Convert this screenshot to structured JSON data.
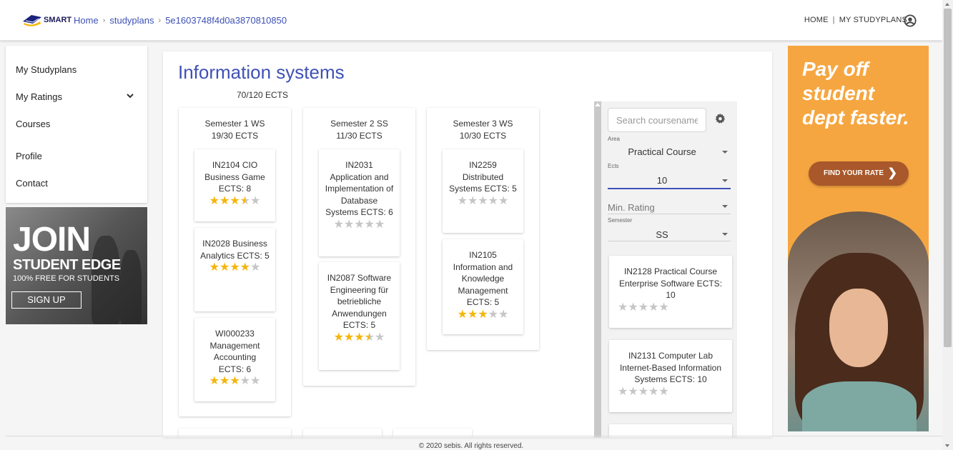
{
  "header": {
    "brand": "SMART",
    "breadcrumbs": [
      "Home",
      "studyplans",
      "5e1603748f4d0a3870810850"
    ],
    "nav_home": "HOME",
    "nav_separator": "|",
    "nav_studyplans": "MY STUDYPLANS"
  },
  "sidebar": {
    "items": [
      {
        "label": "My Studyplans"
      },
      {
        "label": "My Ratings"
      },
      {
        "label": "Courses"
      },
      {
        "label": "Profile"
      },
      {
        "label": "Contact"
      }
    ]
  },
  "ad_left": {
    "line1": "JOIN",
    "line2": "STUDENT EDGE",
    "line3": "100% FREE FOR STUDENTS",
    "button": "SIGN UP"
  },
  "plan": {
    "title": "Information systems",
    "ects_progress": "70/120 ECTS",
    "ects_done": 70,
    "ects_required": 120,
    "semesters": [
      {
        "title": "Semester 1 WS",
        "ects": "19/30 ECTS",
        "courses": [
          {
            "text": "IN2104 CIO Business Game ECTS: 8",
            "rating": 3.5
          },
          {
            "text": "IN2028 Business Analytics ECTS: 5",
            "rating": 4
          },
          {
            "text": "WI000233 Management Accounting ECTS: 6",
            "rating": 3
          }
        ]
      },
      {
        "title": "Semester 2 SS",
        "ects": "11/30 ECTS",
        "courses": [
          {
            "text": "IN2031 Application and Implementation of Database Systems ECTS: 6",
            "rating": 0
          },
          {
            "text": "IN2087 Software Engineering für betriebliche Anwendungen ECTS: 5",
            "rating": 3.5
          }
        ]
      },
      {
        "title": "Semester 3 WS",
        "ects": "10/30 ECTS",
        "courses": [
          {
            "text": "IN2259 Distributed Systems ECTS: 5",
            "rating": 0
          },
          {
            "text": "IN2105 Information and Knowledge Management ECTS: 5",
            "rating": 3
          }
        ]
      }
    ]
  },
  "filters": {
    "search_placeholder": "Search coursename",
    "area_label": "Area",
    "area_value": "Practical Course",
    "ects_label": "Ects",
    "ects_value": "10",
    "rating_placeholder": "Min. Rating",
    "semester_label": "Semester",
    "semester_value": "SS"
  },
  "results": [
    {
      "text": "IN2128 Practical Course Enterprise Software ECTS: 10",
      "rating": 0
    },
    {
      "text": "IN2131 Computer Lab Internet-Based Information Systems ECTS: 10",
      "rating": 0
    }
  ],
  "ad_right": {
    "line1": "Pay off",
    "line2": "student",
    "line3": "dept faster.",
    "button": "FIND YOUR RATE"
  },
  "footer": "© 2020 sebis. All rights reserved.",
  "colors": {
    "accent": "#3f51b5",
    "star_on": "#f5b50a",
    "star_off": "#c6c6c6",
    "ad_orange": "#f6a640"
  },
  "icons": {
    "logo": "graduation-cap-icon",
    "account": "account-circle-icon",
    "chevron": "chevron-down-icon",
    "settings": "gear-icon"
  }
}
